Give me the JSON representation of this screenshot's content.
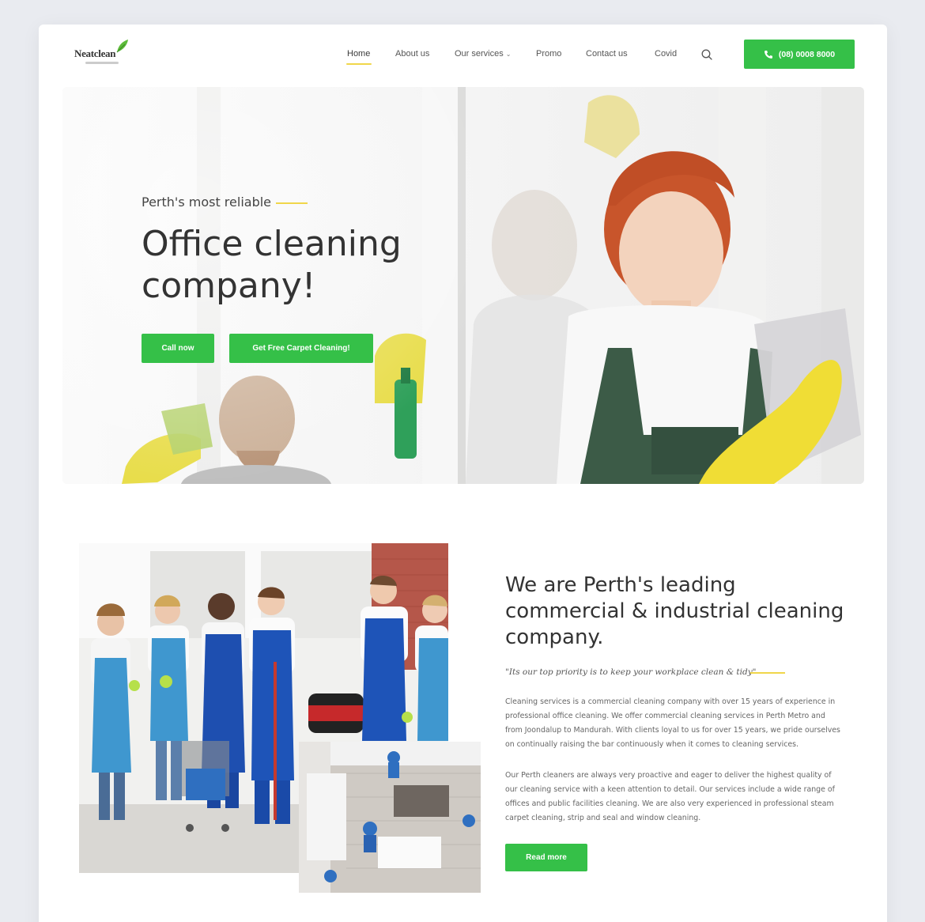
{
  "brand": {
    "name": "Neatclean"
  },
  "nav": {
    "items": [
      {
        "label": "Home"
      },
      {
        "label": "About us"
      },
      {
        "label": "Our services"
      },
      {
        "label": "Promo"
      },
      {
        "label": "Contact us"
      },
      {
        "label": "Covid"
      }
    ],
    "phone": "(08) 0008 8000"
  },
  "hero": {
    "eyebrow": "Perth's most reliable",
    "title": "Office cleaning company!",
    "call_label": "Call now",
    "carpet_label": "Get Free Carpet Cleaning!"
  },
  "about": {
    "title": "We are Perth's leading commercial & industrial cleaning company.",
    "quote": "\"Its our top priority is to keep your workplace clean & tidy\"",
    "para1": "Cleaning services is a commercial cleaning company with over 15 years of experience in professional office cleaning. We offer commercial cleaning services in Perth Metro and from Joondalup to Mandurah. With clients loyal to us for over 15 years, we pride ourselves on continually raising the bar continuously when it comes to cleaning services.",
    "para2": "Our Perth cleaners are always very proactive and eager to deliver the highest quality of our cleaning service with a keen attention to detail. Our services include a wide range of offices and public facilities cleaning. We are also very experienced in professional steam carpet cleaning, strip and seal and window cleaning.",
    "read_more": "Read more"
  },
  "colors": {
    "accent": "#35c048",
    "highlight": "#f0d64a",
    "page_bg": "#e9ebf0"
  }
}
